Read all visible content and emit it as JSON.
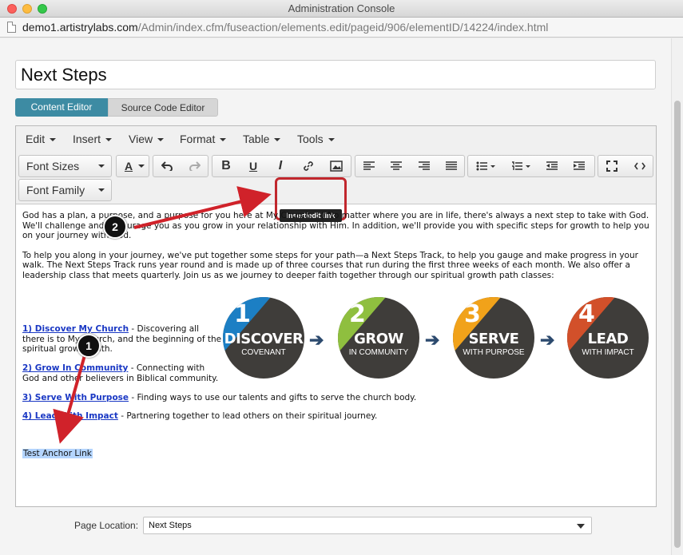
{
  "window": {
    "title": "Administration Console"
  },
  "url": {
    "host": "demo1.artistrylabs.com",
    "path": "/Admin/index.cfm/fuseaction/elements.edit/pageid/906/elementID/14224/index.html"
  },
  "page_title_value": "Next Steps",
  "tabs": [
    {
      "label": "Content Editor"
    },
    {
      "label": "Source Code Editor"
    }
  ],
  "menu": [
    {
      "label": "Edit"
    },
    {
      "label": "Insert"
    },
    {
      "label": "View"
    },
    {
      "label": "Format"
    },
    {
      "label": "Table"
    },
    {
      "label": "Tools"
    }
  ],
  "toolbar": {
    "font_sizes": "Font Sizes",
    "font_family": "Font Family",
    "text_color": "A",
    "bold": "B",
    "underline": "U",
    "italic": "I",
    "tooltip": "Insert/edit link"
  },
  "body": {
    "para1": "God has a plan, a purpose, and a purpose for you here at My Church. :-) No matter where you are in life, there's always a next step to take with God. We'll challenge and encourage you as you grow in your relationship with Him. In addition, we'll provide you with specific steps for growth to help you on your journey with God.",
    "para2": "To help you along in your journey, we've put together some steps for your path—a Next Steps Track, to help you gauge and make progress in your walk. The Next Steps Track runs year round and is made up of three courses that run during the first three weeks of each month. We also offer a leadership class that meets quarterly. Join us as we journey to deeper faith together through our spiritual growth path classes:",
    "links": [
      {
        "link": "1) Discover My Church",
        "text": " - Discovering all",
        "text2": "there is to My Church, and the beginning of the",
        "text3": "spiritual growth path."
      },
      {
        "link": "2) Grow In Community",
        "text": " - Connecting with",
        "text2": "God and other believers in Biblical community."
      },
      {
        "link": "3) Serve With Purpose",
        "text": " - Finding ways to use our talents and gifts to serve the church body."
      },
      {
        "link": "4) Lead With Impact",
        "text": " - Partnering together to lead others on their spiritual journey."
      }
    ],
    "anchor": "Test Anchor Link"
  },
  "steps": [
    {
      "num": "1",
      "big": "DISCOVER",
      "small": "COVENANT",
      "accent": "#1c7fc4"
    },
    {
      "num": "2",
      "big": "GROW",
      "small": "IN COMMUNITY",
      "accent": "#8fbf3f"
    },
    {
      "num": "3",
      "big": "SERVE",
      "small": "WITH PURPOSE",
      "accent": "#f1a21a"
    },
    {
      "num": "4",
      "big": "LEAD",
      "small": "WITH IMPACT",
      "accent": "#d2502a"
    }
  ],
  "callouts": [
    {
      "num": "1"
    },
    {
      "num": "2"
    }
  ],
  "page_location": {
    "label": "Page Location:",
    "value": "Next Steps"
  }
}
